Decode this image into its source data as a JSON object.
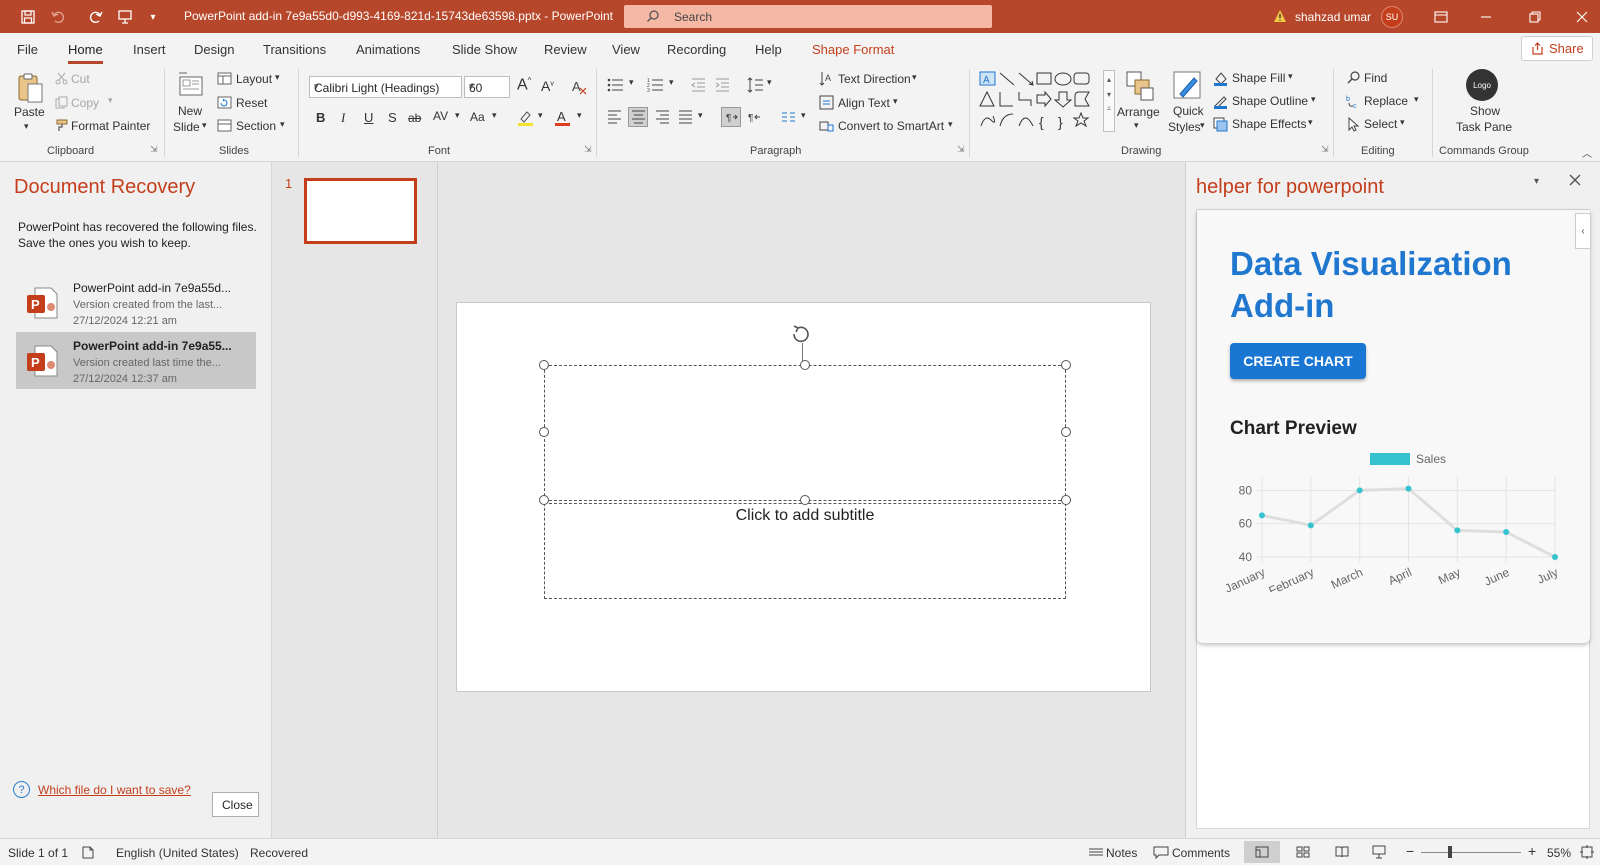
{
  "window": {
    "title": "PowerPoint add-in 7e9a55d0-d993-4169-821d-15743de63598.pptx  -  PowerPoint",
    "search_placeholder": "Search",
    "user_name": "shahzad umar",
    "user_initials": "SU"
  },
  "tabs": [
    "File",
    "Home",
    "Insert",
    "Design",
    "Transitions",
    "Animations",
    "Slide Show",
    "Review",
    "View",
    "Recording",
    "Help",
    "Shape Format"
  ],
  "share_label": "Share",
  "ribbon": {
    "clipboard": {
      "paste": "Paste",
      "cut": "Cut",
      "copy": "Copy",
      "format_painter": "Format Painter",
      "group": "Clipboard"
    },
    "slides": {
      "new_slide_1": "New",
      "new_slide_2": "Slide",
      "layout": "Layout",
      "reset": "Reset",
      "section": "Section",
      "group": "Slides"
    },
    "font": {
      "family": "Calibri Light (Headings)",
      "size": "60",
      "bold": "B",
      "italic": "I",
      "underline": "U",
      "shadow": "S",
      "strike": "ab",
      "spacing": "AV",
      "case": "Aa",
      "group": "Font"
    },
    "paragraph": {
      "text_direction": "Text Direction",
      "align_text": "Align Text",
      "smartart": "Convert to SmartArt",
      "group": "Paragraph"
    },
    "drawing": {
      "arrange": "Arrange",
      "quick_styles_1": "Quick",
      "quick_styles_2": "Styles",
      "shape_fill": "Shape Fill",
      "shape_outline": "Shape Outline",
      "shape_effects": "Shape Effects",
      "group": "Drawing"
    },
    "editing": {
      "find": "Find",
      "replace": "Replace",
      "select": "Select",
      "group": "Editing"
    },
    "commands": {
      "logo": "Logo",
      "show_1": "Show",
      "show_2": "Task Pane",
      "group": "Commands Group"
    }
  },
  "recovery": {
    "title": "Document Recovery",
    "description": "PowerPoint has recovered the following files.  Save the ones you wish to keep.",
    "items": [
      {
        "name": "PowerPoint add-in 7e9a55d...",
        "version": "Version created from the last...",
        "timestamp": "27/12/2024 12:21 am"
      },
      {
        "name": "PowerPoint add-in 7e9a55...",
        "version": "Version created last time the...",
        "timestamp": "27/12/2024 12:37 am"
      }
    ],
    "help_link": "Which file do I want to save?",
    "close": "Close"
  },
  "thumbnails": {
    "slide_number": "1"
  },
  "slide": {
    "subtitle_placeholder": "Click to add subtitle"
  },
  "addin": {
    "pane_title": "helper for powerpoint",
    "heading": "Data Visualization Add-in",
    "create_button": "CREATE CHART",
    "chart_preview_title": "Chart Preview"
  },
  "chart_data": {
    "type": "line",
    "categories": [
      "January",
      "February",
      "March",
      "April",
      "May",
      "June",
      "July"
    ],
    "series": [
      {
        "name": "Sales",
        "values": [
          65,
          59,
          80,
          81,
          56,
          55,
          40
        ],
        "color": "#36c2cf"
      }
    ],
    "title": "",
    "xlabel": "",
    "ylabel": "",
    "ylim": [
      40,
      85
    ],
    "yticks": [
      40,
      60,
      80
    ],
    "grid": true,
    "legend": "top"
  },
  "statusbar": {
    "slide_of": "Slide 1 of 1",
    "language": "English (United States)",
    "state": "Recovered",
    "notes": "Notes",
    "comments": "Comments",
    "zoom": "55%"
  },
  "colors": {
    "accent": "#b7472a",
    "accent_text": "#c43e1c",
    "addin_blue": "#1976d2",
    "series": "#36c2cf"
  }
}
